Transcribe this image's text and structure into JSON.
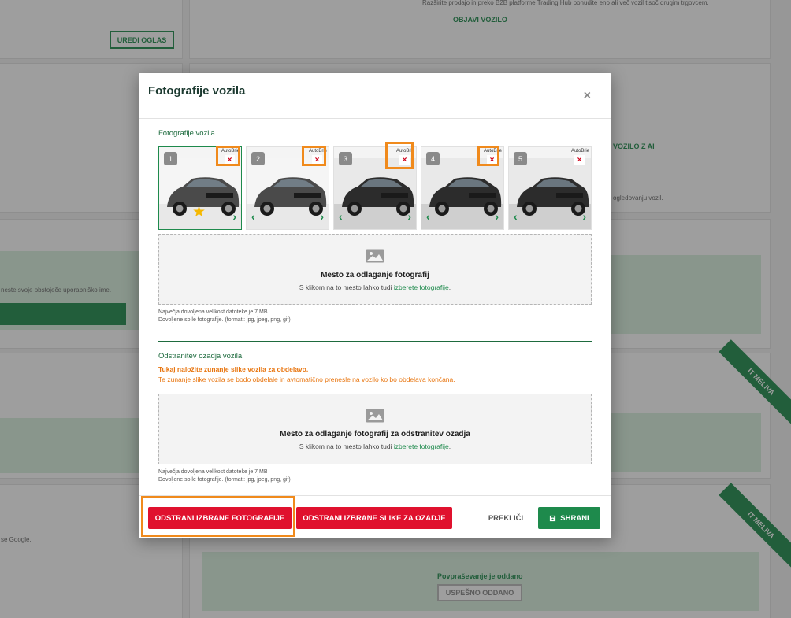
{
  "background": {
    "edit_listing_button": "UREDI OGLAS",
    "publish_link": "OBJAVI VOZILO",
    "publish_text": "Razširite prodajo in preko B2B platforme Trading Hub ponudite eno ali več vozil tisoč drugim trgovcem.",
    "ai_link": "VOZILO Z AI",
    "ai_text": "ogledovanju vozil.",
    "username_text": "neste svoje obstoječe uporabniško ime.",
    "google_text": "se Google.",
    "ribbon_label": "IT MELIVA",
    "inquiry_sent": "Povpraševanje je oddano",
    "success_button": "USPEŠNO ODDANO"
  },
  "modal": {
    "title": "Fotografije vozila",
    "close_label": "×",
    "photos_section_label": "Fotografije vozila",
    "thumbnails": [
      {
        "number": "1",
        "logo": "AutoBrie",
        "remove": "×",
        "featured": true
      },
      {
        "number": "2",
        "logo": "AutoBrie",
        "remove": "×",
        "featured": false
      },
      {
        "number": "3",
        "logo": "AutoBrie",
        "remove": "×",
        "featured": false
      },
      {
        "number": "4",
        "logo": "AutoBrie",
        "remove": "×",
        "featured": false
      },
      {
        "number": "5",
        "logo": "AutoBrie",
        "remove": "×",
        "featured": false
      }
    ],
    "dropzone1": {
      "title": "Mesto za odlaganje fotografij",
      "subtitle_prefix": "S klikom na to mesto lahko tudi ",
      "subtitle_link": "izberete fotografije",
      "subtitle_suffix": "."
    },
    "hint1_line1": "Največja dovoljena velikost datoteke je 7 MB",
    "hint1_line2": "Dovoljene so le fotografije. (formati: jpg, jpeg, png, gif)",
    "bg_section_label": "Odstranitev ozadja vozila",
    "bg_warning_bold": "Tukaj naložite zunanje slike vozila za obdelavo.",
    "bg_warning": "Te zunanje slike vozila se bodo obdelale in avtomatično prenesle na vozilo ko bo obdelava končana.",
    "dropzone2": {
      "title": "Mesto za odlaganje fotografij za odstranitev ozadja",
      "subtitle_prefix": "S klikom na to mesto lahko tudi ",
      "subtitle_link": "izberete fotografije",
      "subtitle_suffix": "."
    },
    "hint2_line1": "Največja dovoljena velikost datoteke je 7 MB",
    "hint2_line2": "Dovoljene so le fotografije. (formati: jpg, jpeg, png, gif)",
    "footer": {
      "remove_selected_photos": "ODSTRANI IZBRANE FOTOGRAFIJE",
      "remove_selected_bg_images": "ODSTRANI IZBRANE SLIKE ZA OZADJE",
      "cancel": "PREKLIČI",
      "save": "SHRANI"
    }
  },
  "colors": {
    "brand_green": "#1e8a4c",
    "danger_red": "#e0112e",
    "warning_orange": "#e8750f",
    "highlight_orange": "#f08a1c"
  },
  "icons": [
    "close-icon",
    "remove-icon",
    "star-icon",
    "chevron-left-icon",
    "chevron-right-icon",
    "image-icon",
    "save-icon"
  ]
}
